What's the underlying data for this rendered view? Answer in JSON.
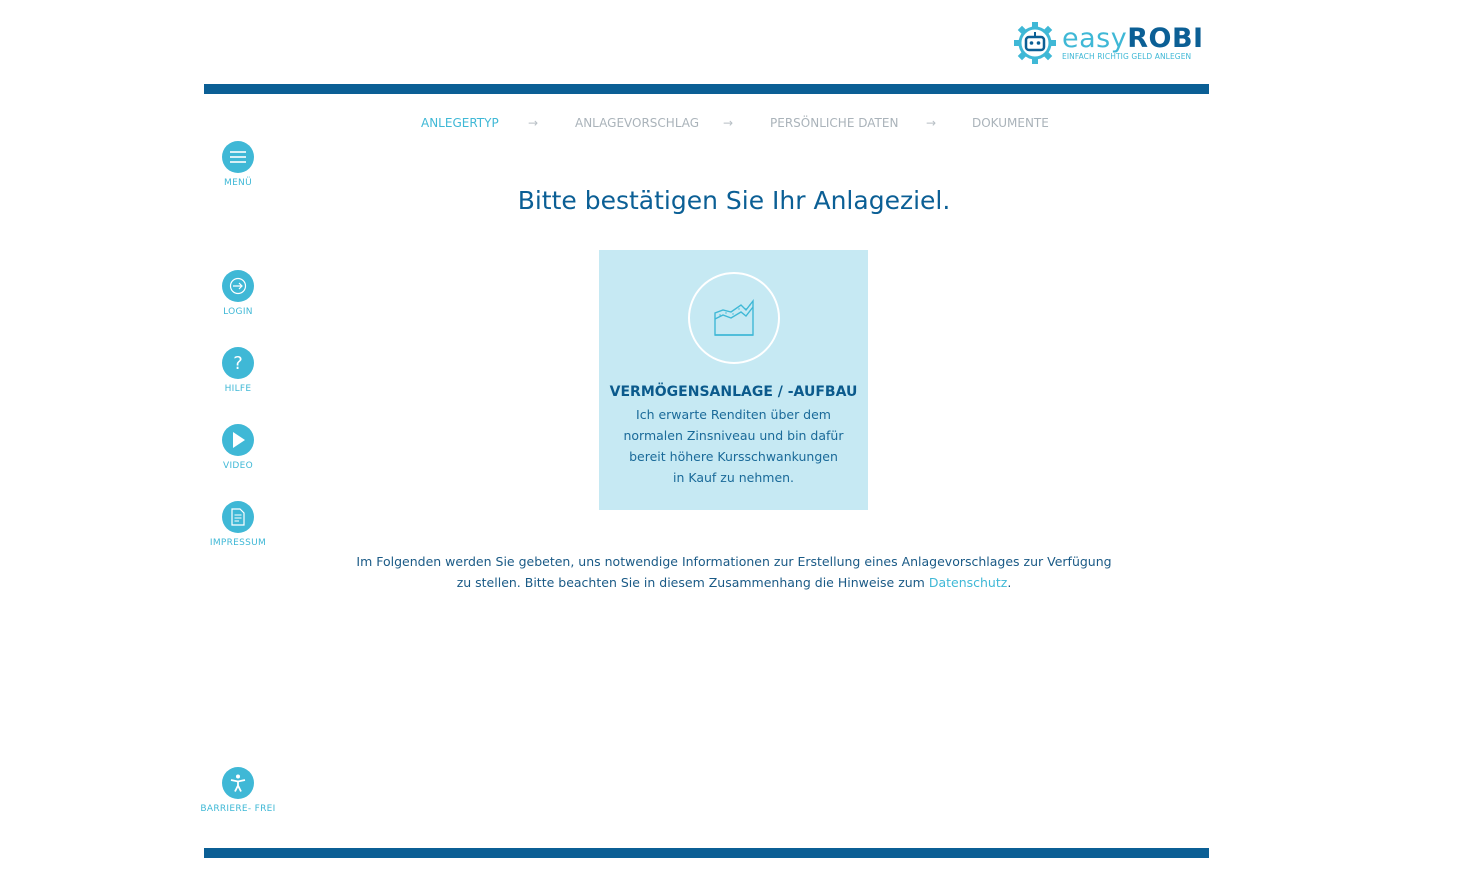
{
  "logo": {
    "main_light": "easy",
    "main_bold": "ROBI",
    "tagline": "EINFACH RICHTIG GELD ANLEGEN"
  },
  "steps": [
    {
      "label": "ANLEGERTYP",
      "active": true
    },
    {
      "label": "ANLAGEVORSCHLAG",
      "active": false
    },
    {
      "label": "PERSÖNLICHE DATEN",
      "active": false
    },
    {
      "label": "DOKUMENTE",
      "active": false
    }
  ],
  "step_arrow": "→",
  "sidebar": {
    "menu": "MENÜ",
    "login": "LOGIN",
    "help": "HILFE",
    "help_glyph": "?",
    "video": "VIDEO",
    "imprint": "IMPRESSUM",
    "accessibility": "BARRIERE- FREI"
  },
  "title": "Bitte bestätigen Sie Ihr Anlageziel.",
  "card": {
    "title": "VERMÖGENSANLAGE / -AUFBAU",
    "text": "Ich erwarte Renditen über dem nor­malen Zinsniveau und bin dafür be­reit höhere Kursschwankungen in Kauf zu nehmen."
  },
  "info": {
    "text": "Im Folgenden werden Sie gebeten, uns notwendige Informationen zur Erstellung eines Anlagevorschlages zur Verfügung zu stellen. Bitte beachten Sie in diesem Zusammenhang die Hinweise zum ",
    "link": "Datenschutz",
    "end": "."
  },
  "colors": {
    "primary": "#0b5f95",
    "accent": "#3fb8d6",
    "card": "#c6e9f3"
  }
}
